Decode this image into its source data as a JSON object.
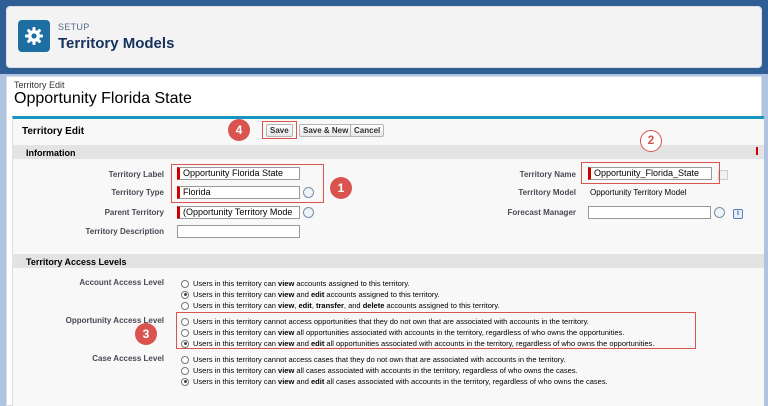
{
  "header": {
    "setup_label": "SETUP",
    "title": "Territory Models",
    "icon": "gear-icon"
  },
  "record": {
    "breadcrumb": "Territory Edit",
    "title": "Opportunity Florida State"
  },
  "edit": {
    "title": "Territory Edit",
    "buttons": {
      "save": "Save",
      "save_new": "Save & New",
      "cancel": "Cancel"
    }
  },
  "information": {
    "section_title": "Information",
    "territory_label": {
      "label": "Territory Label",
      "value": "Opportunity Florida State"
    },
    "territory_type": {
      "label": "Territory Type",
      "value": "Florida"
    },
    "parent_territory": {
      "label": "Parent Territory",
      "value": "(Opportunity Territory Mode"
    },
    "territory_description": {
      "label": "Territory Description",
      "value": ""
    },
    "territory_name": {
      "label": "Territory Name",
      "value": "Opportunity_Florida_State"
    },
    "territory_model": {
      "label": "Territory Model",
      "value": "Opportunity Territory Model"
    },
    "forecast_manager": {
      "label": "Forecast Manager",
      "value": ""
    }
  },
  "access": {
    "section_title": "Territory Access Levels",
    "account": {
      "label": "Account Access Level",
      "options": [
        {
          "parts": [
            "Users in this territory can ",
            "view",
            " accounts assigned to this territory."
          ],
          "selected": false
        },
        {
          "parts": [
            "Users in this territory can ",
            "view",
            " and ",
            "edit",
            " accounts assigned to this territory."
          ],
          "selected": true
        },
        {
          "parts": [
            "Users in this territory can ",
            "view",
            ", ",
            "edit",
            ", ",
            "transfer",
            ", and ",
            "delete",
            " accounts assigned to this territory."
          ],
          "selected": false
        }
      ]
    },
    "opportunity": {
      "label": "Opportunity Access Level",
      "options": [
        {
          "parts": [
            "Users in this territory cannot access opportunities that they do not own that are associated with accounts in the territory."
          ],
          "selected": false
        },
        {
          "parts": [
            "Users in this territory can ",
            "view",
            " all opportunities associated with accounts in the territory, regardless of who owns the opportunities."
          ],
          "selected": false
        },
        {
          "parts": [
            "Users in this territory can ",
            "view",
            " and ",
            "edit",
            " all opportunities associated with accounts in the territory, regardless of who owns the opportunities."
          ],
          "selected": true
        }
      ]
    },
    "case": {
      "label": "Case Access Level",
      "options": [
        {
          "parts": [
            "Users in this territory cannot access cases that they do not own that are associated with accounts in the territory."
          ],
          "selected": false
        },
        {
          "parts": [
            "Users in this territory can ",
            "view",
            " all cases associated with accounts in the territory, regardless of who owns the cases."
          ],
          "selected": false
        },
        {
          "parts": [
            "Users in this territory can ",
            "view",
            " and ",
            "edit",
            " all cases associated with accounts in the territory, regardless of who owns the cases."
          ],
          "selected": true
        }
      ]
    }
  },
  "annotations": {
    "step1": "1",
    "step2": "2",
    "step3": "3",
    "step4": "4"
  },
  "colors": {
    "accent_red": "#d9534f",
    "header_blue": "#2f5e94",
    "section_top": "#1797c0"
  }
}
